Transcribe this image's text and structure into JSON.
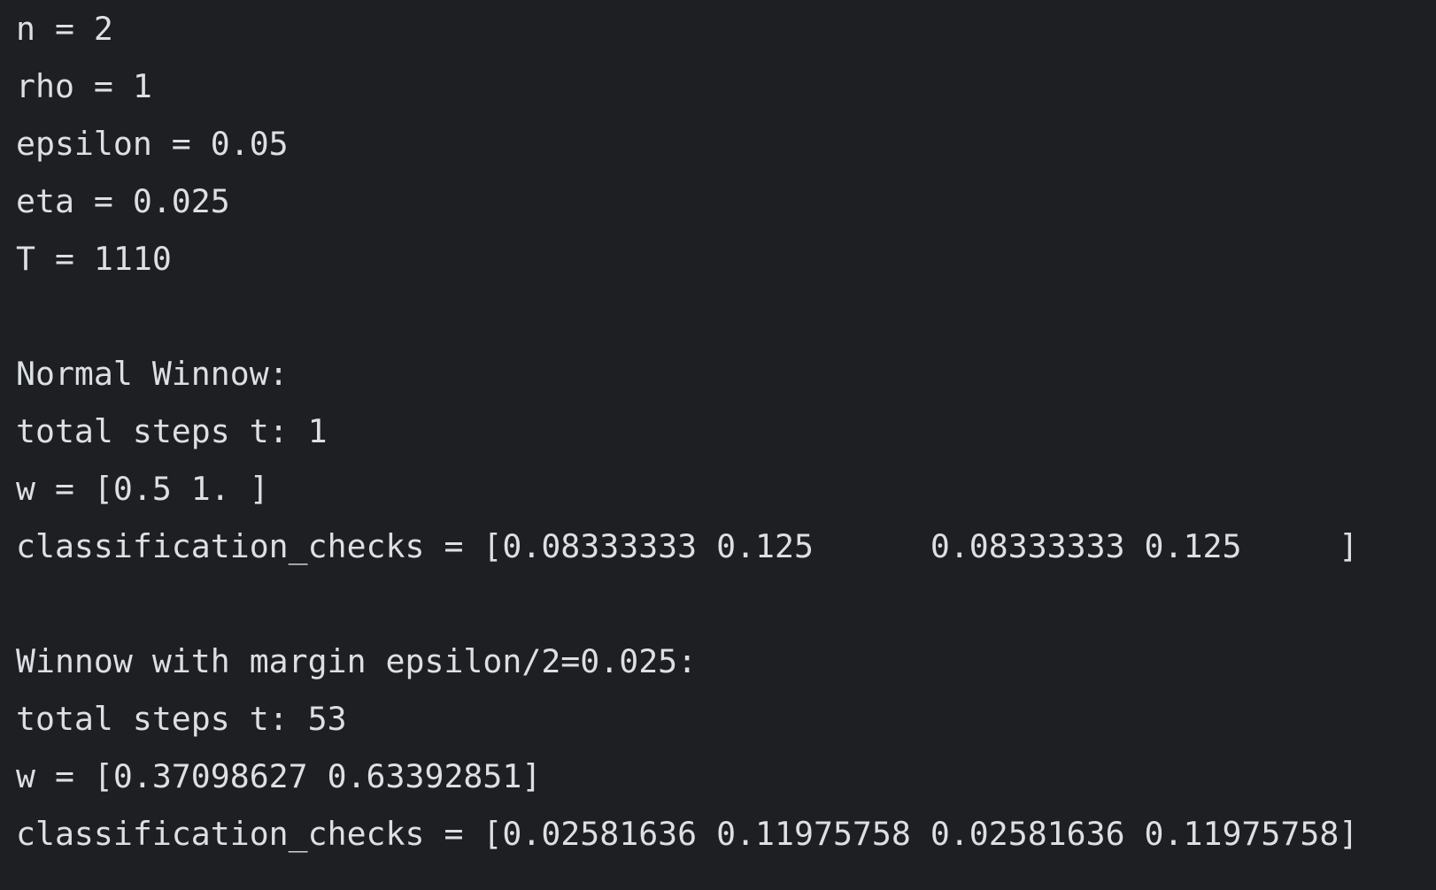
{
  "console": {
    "lines": [
      "n = 2",
      "rho = 1",
      "epsilon = 0.05",
      "eta = 0.025",
      "T = 1110",
      "",
      "Normal Winnow:",
      "total steps t: 1",
      "w = [0.5 1. ]",
      "classification_checks = [0.08333333 0.125      0.08333333 0.125     ]",
      "",
      "Winnow with margin epsilon/2=0.025:",
      "total steps t: 53",
      "w = [0.37098627 0.63392851]",
      "classification_checks = [0.02581636 0.11975758 0.02581636 0.11975758]"
    ]
  },
  "colors": {
    "background": "#1e1f22",
    "text": "#dcdfe4"
  }
}
